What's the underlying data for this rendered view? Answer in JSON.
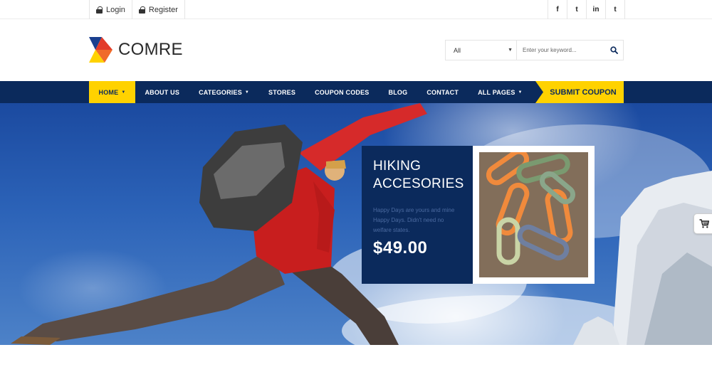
{
  "topbar": {
    "login_label": "Login",
    "register_label": "Register",
    "social": [
      {
        "icon": "facebook-icon",
        "glyph": "f"
      },
      {
        "icon": "twitter-icon",
        "glyph": "t"
      },
      {
        "icon": "linkedin-icon",
        "glyph": "in"
      },
      {
        "icon": "tumblr-icon",
        "glyph": "t"
      }
    ]
  },
  "header": {
    "logo_text": "COMRE",
    "search": {
      "category_value": "All",
      "placeholder": "Enter your keyword..."
    }
  },
  "nav": {
    "items": [
      {
        "label": "HOME",
        "dropdown": true,
        "active": true
      },
      {
        "label": "ABOUT US",
        "dropdown": false,
        "active": false
      },
      {
        "label": "CATEGORIES",
        "dropdown": true,
        "active": false
      },
      {
        "label": "STORES",
        "dropdown": false,
        "active": false
      },
      {
        "label": "COUPON CODES",
        "dropdown": false,
        "active": false
      },
      {
        "label": "BLOG",
        "dropdown": false,
        "active": false
      },
      {
        "label": "CONTACT",
        "dropdown": false,
        "active": false
      },
      {
        "label": "ALL PAGES",
        "dropdown": true,
        "active": false
      }
    ],
    "coupon_label": "SUBMIT COUPON"
  },
  "hero": {
    "promo": {
      "title_line1": "HIKING",
      "title_line2": "ACCESORIES",
      "description": "Happy Days are yours and mine Happy Days. Didn't need no welfare states.",
      "price": "$49.00"
    }
  },
  "colors": {
    "navy": "#0b2a5c",
    "accent_yellow": "#ffd200",
    "logo_red": "#e23c2a",
    "logo_blue": "#1a3f8f"
  }
}
